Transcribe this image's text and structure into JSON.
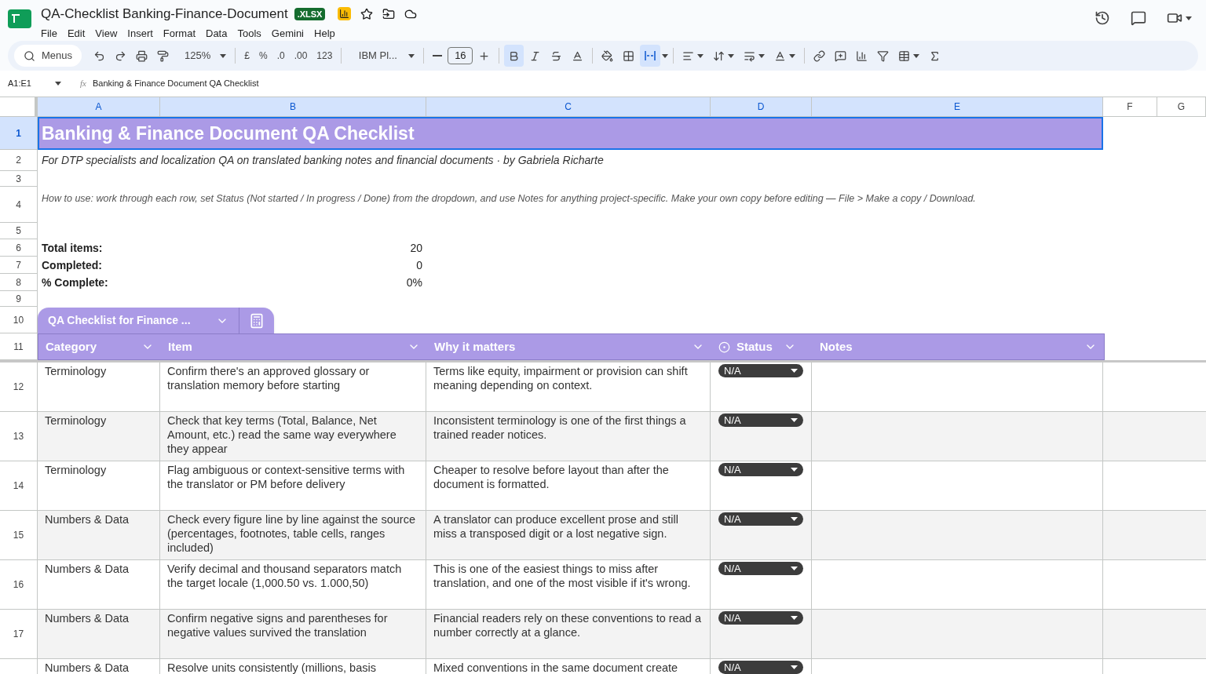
{
  "document": {
    "title": "QA-Checklist Banking-Finance-Document",
    "format_badge": ".XLSX"
  },
  "menu": [
    {
      "label": "File"
    },
    {
      "label": "Edit"
    },
    {
      "label": "View"
    },
    {
      "label": "Insert"
    },
    {
      "label": "Format"
    },
    {
      "label": "Data"
    },
    {
      "label": "Tools"
    },
    {
      "label": "Gemini"
    },
    {
      "label": "Help"
    }
  ],
  "toolbar": {
    "search_label": "Menus",
    "zoom": "125%",
    "currency": "£",
    "percent": "%",
    "decrease_decimal": ".0",
    "increase_decimal": ".00",
    "number_format": "123",
    "font": "IBM Pl...",
    "font_size": "16",
    "bold_selected": true,
    "merge_selected": true
  },
  "formula_bar": {
    "cell_ref": "A1:E1",
    "function_label": "fx",
    "content": "Banking & Finance Document QA Checklist"
  },
  "columns": [
    {
      "label": "A",
      "selected": true
    },
    {
      "label": "B",
      "selected": true
    },
    {
      "label": "C",
      "selected": true
    },
    {
      "label": "D",
      "selected": true
    },
    {
      "label": "E",
      "selected": true
    },
    {
      "label": "F",
      "selected": false
    },
    {
      "label": "G",
      "selected": false
    }
  ],
  "sheet": {
    "row_numbers": [
      {
        "label": "1",
        "selected": true
      },
      {
        "label": "2",
        "selected": false
      },
      {
        "label": "3",
        "selected": false
      },
      {
        "label": "4",
        "selected": false
      },
      {
        "label": "5",
        "selected": false
      },
      {
        "label": "6",
        "selected": false
      },
      {
        "label": "7",
        "selected": false
      },
      {
        "label": "8",
        "selected": false
      },
      {
        "label": "9",
        "selected": false
      },
      {
        "label": "10",
        "selected": false
      },
      {
        "label": "11",
        "selected": false
      }
    ],
    "title": "Banking & Finance Document QA Checklist",
    "subtitle": "For DTP specialists and localization QA on translated banking notes and financial documents · by Gabriela Richarte",
    "how_to": "How to use: work through each row, set Status (Not started / In progress / Done) from the dropdown, and use Notes for anything project-specific. Make your own copy before editing — File > Make a copy / Download.",
    "summary": [
      {
        "label": "Total items:",
        "value": "20"
      },
      {
        "label": "Completed:",
        "value": "0"
      },
      {
        "label": "% Complete:",
        "value": "0%"
      }
    ],
    "table_name": "QA Checklist for Finance ...",
    "table_headers": [
      {
        "label": "Category",
        "kind": "text"
      },
      {
        "label": "Item",
        "kind": "text"
      },
      {
        "label": "Why it matters",
        "kind": "text"
      },
      {
        "label": "Status",
        "kind": "dropdown"
      },
      {
        "label": "Notes",
        "kind": "text"
      }
    ],
    "rows": [
      {
        "number": "12",
        "category": "Terminology",
        "item": "Confirm there's an approved glossary or translation memory before starting",
        "why": "Terms like equity, impairment or provision can shift meaning depending on context.",
        "status": "N/A"
      },
      {
        "number": "13",
        "category": "Terminology",
        "item": "Check that key terms (Total, Balance, Net Amount, etc.) read the same way everywhere they appear",
        "why": "Inconsistent terminology is one of the first things a trained reader notices.",
        "status": "N/A"
      },
      {
        "number": "14",
        "category": "Terminology",
        "item": "Flag ambiguous or context-sensitive terms with the translator or PM before delivery",
        "why": "Cheaper to resolve before layout than after the document is formatted.",
        "status": "N/A"
      },
      {
        "number": "15",
        "category": "Numbers & Data",
        "item": "Check every figure line by line against the source (percentages, footnotes, table cells, ranges included)",
        "why": "A translator can produce excellent prose and still miss a transposed digit or a lost negative sign.",
        "status": "N/A"
      },
      {
        "number": "16",
        "category": "Numbers & Data",
        "item": "Verify decimal and thousand separators match the target locale (1,000.50 vs. 1.000,50)",
        "why": "This is one of the easiest things to miss after translation, and one of the most visible if it's wrong.",
        "status": "N/A"
      },
      {
        "number": "17",
        "category": "Numbers & Data",
        "item": "Confirm negative signs and parentheses for negative values survived the translation",
        "why": "Financial readers rely on these conventions to read a number correctly at a glance.",
        "status": "N/A"
      },
      {
        "category": "Numbers & Data",
        "item": "Resolve units consistently (millions, basis",
        "why": "Mixed conventions in the same document create",
        "status": "N/A"
      }
    ]
  }
}
